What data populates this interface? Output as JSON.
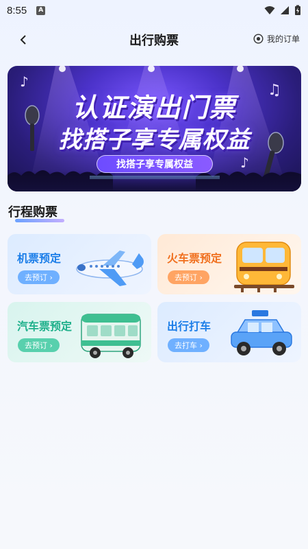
{
  "status": {
    "time": "8:55",
    "a_badge": "A"
  },
  "nav": {
    "title": "出行购票",
    "orders_label": "我的订单"
  },
  "banner": {
    "line1": "认证演出门票",
    "line2": "找搭子享专属权益",
    "pill": "找搭子享专属权益"
  },
  "section": {
    "title": "行程购票"
  },
  "cards": [
    {
      "title": "机票预定",
      "button": "去预订 ›",
      "title_color": "#1c7ee8",
      "button_color": "#6fb0ff"
    },
    {
      "title": "火车票预定",
      "button": "去预订 ›",
      "title_color": "#f0701f",
      "button_color": "#ffa463"
    },
    {
      "title": "汽车票预定",
      "button": "去预订 ›",
      "title_color": "#1fb08b",
      "button_color": "#58d0ad"
    },
    {
      "title": "出行打车",
      "button": "去打车 ›",
      "title_color": "#1c7ee8",
      "button_color": "#6fb0ff"
    }
  ]
}
